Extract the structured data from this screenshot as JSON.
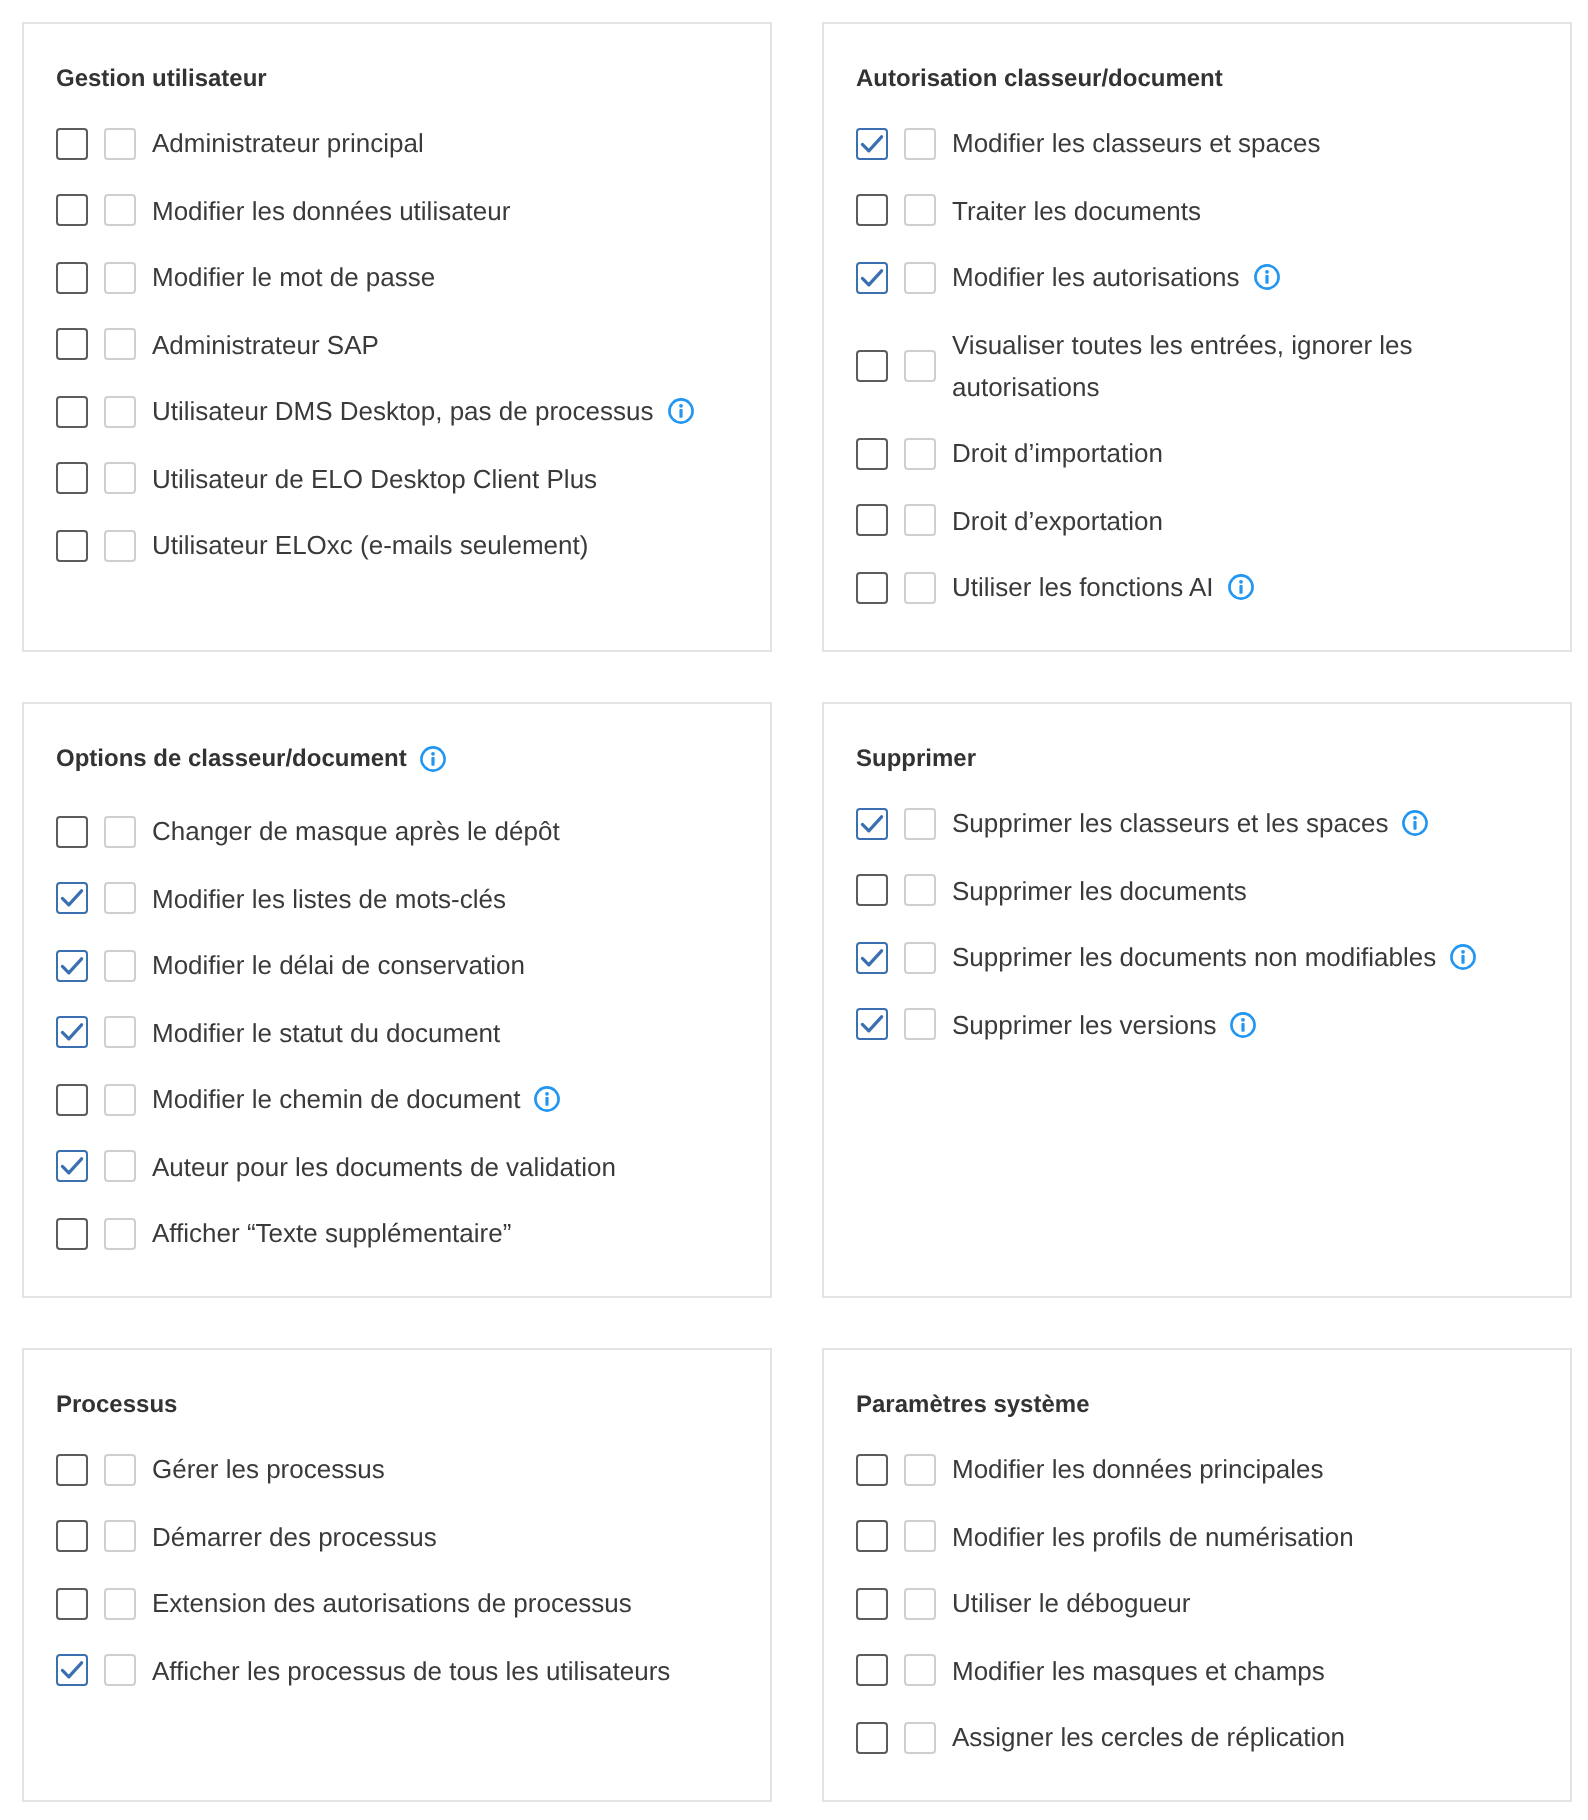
{
  "panels": [
    {
      "title": "Gestion utilisateur",
      "info": false,
      "items": [
        {
          "label": "Administrateur principal",
          "checked": false,
          "second_checked": false,
          "info": false
        },
        {
          "label": "Modifier les données utilisateur",
          "checked": false,
          "second_checked": false,
          "info": false
        },
        {
          "label": "Modifier le mot de passe",
          "checked": false,
          "second_checked": false,
          "info": false
        },
        {
          "label": "Administrateur SAP",
          "checked": false,
          "second_checked": false,
          "info": false
        },
        {
          "label": "Utilisateur DMS Desktop, pas de processus",
          "checked": false,
          "second_checked": false,
          "info": true
        },
        {
          "label": "Utilisateur de ELO Desktop Client Plus",
          "checked": false,
          "second_checked": false,
          "info": false
        },
        {
          "label": "Utilisateur ELOxc (e-mails seulement)",
          "checked": false,
          "second_checked": false,
          "info": false
        }
      ]
    },
    {
      "title": "Autorisation classeur/document",
      "info": false,
      "items": [
        {
          "label": "Modifier les classeurs et spaces",
          "checked": true,
          "second_checked": false,
          "info": false
        },
        {
          "label": "Traiter les documents",
          "checked": false,
          "second_checked": false,
          "info": false
        },
        {
          "label": "Modifier les autorisations",
          "checked": true,
          "second_checked": false,
          "info": true
        },
        {
          "label": "Visualiser toutes les entrées, ignorer les autorisations",
          "checked": false,
          "second_checked": false,
          "info": false
        },
        {
          "label": "Droit d’importation",
          "checked": false,
          "second_checked": false,
          "info": false
        },
        {
          "label": "Droit d’exportation",
          "checked": false,
          "second_checked": false,
          "info": false
        },
        {
          "label": "Utiliser les fonctions AI",
          "checked": false,
          "second_checked": false,
          "info": true
        }
      ]
    },
    {
      "title": "Options de classeur/document",
      "info": true,
      "items": [
        {
          "label": "Changer de masque après le dépôt",
          "checked": false,
          "second_checked": false,
          "info": false
        },
        {
          "label": "Modifier les listes de mots-clés",
          "checked": true,
          "second_checked": false,
          "info": false
        },
        {
          "label": "Modifier le délai de conservation",
          "checked": true,
          "second_checked": false,
          "info": false
        },
        {
          "label": "Modifier le statut du document",
          "checked": true,
          "second_checked": false,
          "info": false
        },
        {
          "label": "Modifier le chemin de document",
          "checked": false,
          "second_checked": false,
          "info": true
        },
        {
          "label": "Auteur pour les documents de validation",
          "checked": true,
          "second_checked": false,
          "info": false
        },
        {
          "label": "Afficher “Texte supplémentaire”",
          "checked": false,
          "second_checked": false,
          "info": false
        }
      ]
    },
    {
      "title": "Supprimer",
      "info": false,
      "items": [
        {
          "label": "Supprimer les classeurs et les spaces",
          "checked": true,
          "second_checked": false,
          "info": true
        },
        {
          "label": "Supprimer les documents",
          "checked": false,
          "second_checked": false,
          "info": false
        },
        {
          "label": "Supprimer les documents non modifiables",
          "checked": true,
          "second_checked": false,
          "info": true
        },
        {
          "label": "Supprimer les versions",
          "checked": true,
          "second_checked": false,
          "info": true
        }
      ]
    },
    {
      "title": "Processus",
      "info": false,
      "items": [
        {
          "label": "Gérer les processus",
          "checked": false,
          "second_checked": false,
          "info": false
        },
        {
          "label": "Démarrer des processus",
          "checked": false,
          "second_checked": false,
          "info": false
        },
        {
          "label": "Extension des autorisations de processus",
          "checked": false,
          "second_checked": false,
          "info": false
        },
        {
          "label": "Afficher les processus de tous les utilisateurs",
          "checked": true,
          "second_checked": false,
          "info": false
        }
      ]
    },
    {
      "title": "Paramètres système",
      "info": false,
      "items": [
        {
          "label": "Modifier les données principales",
          "checked": false,
          "second_checked": false,
          "info": false
        },
        {
          "label": "Modifier les profils de numérisation",
          "checked": false,
          "second_checked": false,
          "info": false
        },
        {
          "label": "Utiliser le débogueur",
          "checked": false,
          "second_checked": false,
          "info": false
        },
        {
          "label": "Modifier les masques et champs",
          "checked": false,
          "second_checked": false,
          "info": false
        },
        {
          "label": "Assigner les cercles de réplication",
          "checked": false,
          "second_checked": false,
          "info": false
        }
      ]
    }
  ]
}
